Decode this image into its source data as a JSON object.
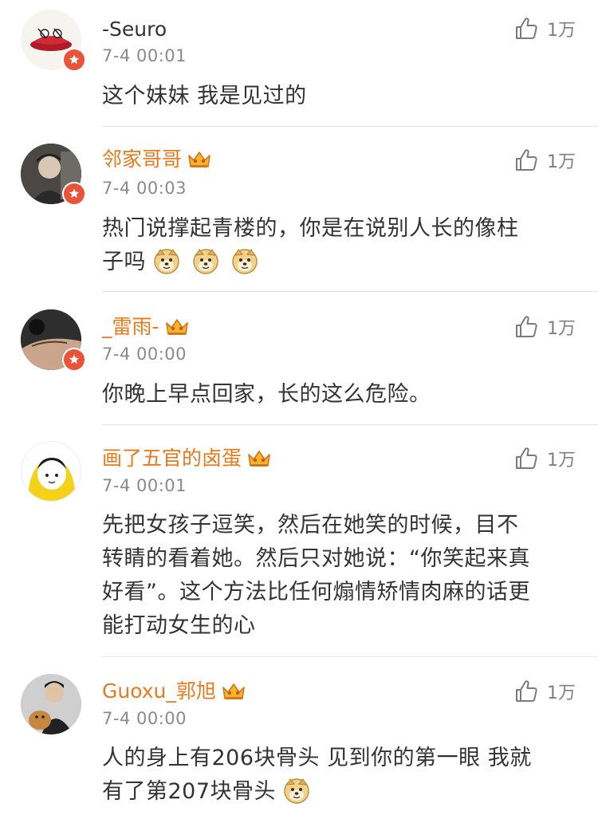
{
  "comments": [
    {
      "user": "-Seuro",
      "time": "7-4 00:01",
      "likes": "1万",
      "text": "这个妹妹 我是见过的",
      "vip": false
    },
    {
      "user": "邻家哥哥",
      "time": "7-4 00:03",
      "likes": "1万",
      "text_line1": "热门说撑起青楼的，你是在说别人长的像柱",
      "text_line2": "子吗",
      "vip": true
    },
    {
      "user": "_雷雨-",
      "time": "7-4 00:00",
      "likes": "1万",
      "text": "你晚上早点回家，长的这么危险。",
      "vip": true
    },
    {
      "user": "画了五官的卤蛋",
      "time": "7-4 00:01",
      "likes": "1万",
      "text_lines": [
        "先把女孩子逗笑，然后在她笑的时候，目不",
        "转睛的看着她。然后只对她说：“你笑起来真",
        "好看”。这个方法比任何煽情矫情肉麻的话更",
        "能打动女生的心"
      ],
      "vip": true
    },
    {
      "user": "Guoxu_郭旭",
      "time": "7-4 00:00",
      "likes": "1万",
      "text_line1": "人的身上有206块骨头 见到你的第一眼 我就",
      "text_line2": "有了第207块骨头",
      "vip": true
    }
  ],
  "colors": {
    "vip_name": "#e87a1d",
    "plain_name": "#333333",
    "timestamp": "#8a8a8a",
    "badge": "#e8533a",
    "divider": "#e6e6e6"
  },
  "icons": {
    "like": "thumbs-up-icon",
    "crown": "vip-crown-icon",
    "badge": "verified-badge-icon",
    "emoji": "doge-emoji-icon"
  }
}
